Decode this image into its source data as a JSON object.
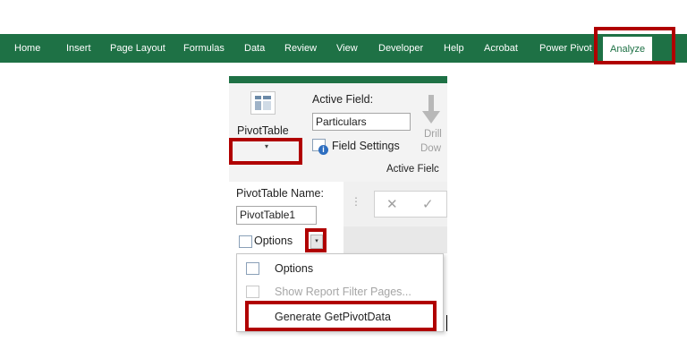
{
  "ribbon": {
    "tabs": [
      "Home",
      "Insert",
      "Page Layout",
      "Formulas",
      "Data",
      "Review",
      "View",
      "Developer",
      "Help",
      "Acrobat",
      "Power Pivot",
      "Analyze"
    ],
    "active_tab": "Analyze",
    "accent_color": "#1e7145",
    "highlight_color": "#b00000"
  },
  "pivottable_group": {
    "label": "PivotTable",
    "icon": "pivottable-icon",
    "dropdown_glyph": "▾"
  },
  "active_field_group": {
    "label": "Active Field:",
    "field_value": "Particulars",
    "field_settings_label": "Field Settings",
    "drill_label_line1": "Drill",
    "drill_label_line2": "Dow",
    "group_caption": "Active Fielc"
  },
  "pivot_name_group": {
    "label": "PivotTable Name:",
    "name_value": "PivotTable1",
    "options_label": "Options",
    "options_dropdown_glyph": "▾"
  },
  "formula_bar": {
    "separator_glyph": "⋮",
    "cancel_glyph": "✕",
    "enter_glyph": "✓"
  },
  "options_menu": {
    "items": [
      {
        "label": "Options",
        "enabled": true,
        "icon": "options-icon"
      },
      {
        "label": "Show Report Filter Pages...",
        "enabled": false,
        "icon": "report-filter-icon"
      },
      {
        "label": "Generate GetPivotData",
        "enabled": true,
        "icon": ""
      }
    ]
  }
}
